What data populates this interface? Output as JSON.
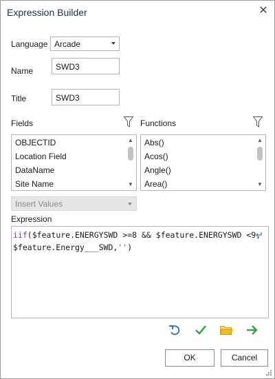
{
  "window": {
    "title": "Expression Builder"
  },
  "language": {
    "label": "Language",
    "value": "Arcade"
  },
  "name": {
    "label": "Name",
    "value": "SWD3"
  },
  "title_field": {
    "label": "Title",
    "value": "SWD3"
  },
  "fields": {
    "label": "Fields",
    "items": [
      "OBJECTID",
      "Location Field",
      "DataName",
      "Site Name"
    ]
  },
  "functions": {
    "label": "Functions",
    "items": [
      "Abs()",
      "Acos()",
      "Angle()",
      "Area()"
    ]
  },
  "insert_values": {
    "label": "Insert Values"
  },
  "expression": {
    "label": "Expression",
    "line1": {
      "fn": "iif",
      "open": "(",
      "var1": "$feature.ENERGYSWD",
      "op1": " >=",
      "num1": "8",
      "op2": " && ",
      "var2": "$feature.ENERGYSWD",
      "op3": " <",
      "num2": "9",
      "comma": ","
    },
    "line2": {
      "var3": "$feature.Energy___SWD",
      "comma": ",",
      "str": "''",
      "close": ")"
    }
  },
  "toolbar": {
    "icons": [
      "undo-icon",
      "check-icon",
      "folder-icon",
      "arrow-right-icon"
    ],
    "colors": {
      "undo": "#2e7fc2",
      "check": "#3aa04a",
      "folder": "#e6a817",
      "arrow": "#3aa04a"
    }
  },
  "buttons": {
    "ok": "OK",
    "cancel": "Cancel"
  }
}
